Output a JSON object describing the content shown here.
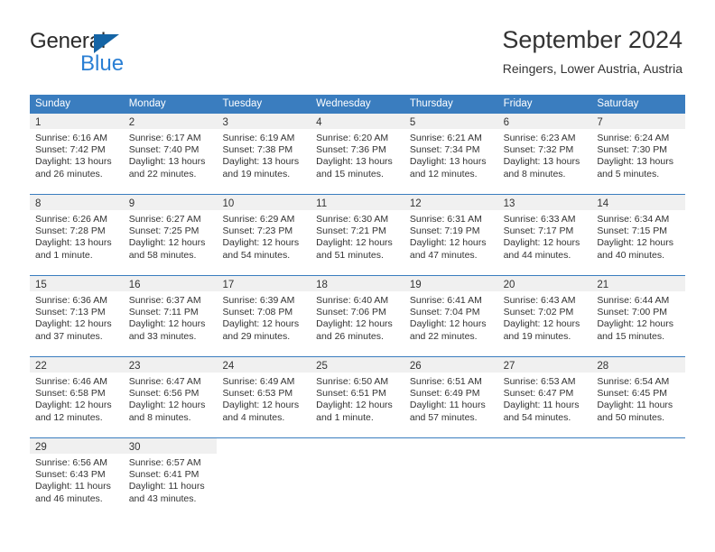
{
  "brand": {
    "name_dark": "General",
    "name_blue": "Blue",
    "triangle_color": "#1464a5",
    "blue_color": "#2a7fd4"
  },
  "header": {
    "title": "September 2024",
    "subtitle": "Reingers, Lower Austria, Austria"
  },
  "theme": {
    "header_bg": "#3a7dbf",
    "header_text": "#ffffff",
    "day_band_bg": "#f0f0f0",
    "row_border": "#3a7dbf",
    "text": "#333333"
  },
  "weekdays": [
    "Sunday",
    "Monday",
    "Tuesday",
    "Wednesday",
    "Thursday",
    "Friday",
    "Saturday"
  ],
  "weeks": [
    {
      "days": [
        {
          "num": "1",
          "sunrise": "Sunrise: 6:16 AM",
          "sunset": "Sunset: 7:42 PM",
          "daylight_1": "Daylight: 13 hours",
          "daylight_2": "and 26 minutes."
        },
        {
          "num": "2",
          "sunrise": "Sunrise: 6:17 AM",
          "sunset": "Sunset: 7:40 PM",
          "daylight_1": "Daylight: 13 hours",
          "daylight_2": "and 22 minutes."
        },
        {
          "num": "3",
          "sunrise": "Sunrise: 6:19 AM",
          "sunset": "Sunset: 7:38 PM",
          "daylight_1": "Daylight: 13 hours",
          "daylight_2": "and 19 minutes."
        },
        {
          "num": "4",
          "sunrise": "Sunrise: 6:20 AM",
          "sunset": "Sunset: 7:36 PM",
          "daylight_1": "Daylight: 13 hours",
          "daylight_2": "and 15 minutes."
        },
        {
          "num": "5",
          "sunrise": "Sunrise: 6:21 AM",
          "sunset": "Sunset: 7:34 PM",
          "daylight_1": "Daylight: 13 hours",
          "daylight_2": "and 12 minutes."
        },
        {
          "num": "6",
          "sunrise": "Sunrise: 6:23 AM",
          "sunset": "Sunset: 7:32 PM",
          "daylight_1": "Daylight: 13 hours",
          "daylight_2": "and 8 minutes."
        },
        {
          "num": "7",
          "sunrise": "Sunrise: 6:24 AM",
          "sunset": "Sunset: 7:30 PM",
          "daylight_1": "Daylight: 13 hours",
          "daylight_2": "and 5 minutes."
        }
      ]
    },
    {
      "days": [
        {
          "num": "8",
          "sunrise": "Sunrise: 6:26 AM",
          "sunset": "Sunset: 7:28 PM",
          "daylight_1": "Daylight: 13 hours",
          "daylight_2": "and 1 minute."
        },
        {
          "num": "9",
          "sunrise": "Sunrise: 6:27 AM",
          "sunset": "Sunset: 7:25 PM",
          "daylight_1": "Daylight: 12 hours",
          "daylight_2": "and 58 minutes."
        },
        {
          "num": "10",
          "sunrise": "Sunrise: 6:29 AM",
          "sunset": "Sunset: 7:23 PM",
          "daylight_1": "Daylight: 12 hours",
          "daylight_2": "and 54 minutes."
        },
        {
          "num": "11",
          "sunrise": "Sunrise: 6:30 AM",
          "sunset": "Sunset: 7:21 PM",
          "daylight_1": "Daylight: 12 hours",
          "daylight_2": "and 51 minutes."
        },
        {
          "num": "12",
          "sunrise": "Sunrise: 6:31 AM",
          "sunset": "Sunset: 7:19 PM",
          "daylight_1": "Daylight: 12 hours",
          "daylight_2": "and 47 minutes."
        },
        {
          "num": "13",
          "sunrise": "Sunrise: 6:33 AM",
          "sunset": "Sunset: 7:17 PM",
          "daylight_1": "Daylight: 12 hours",
          "daylight_2": "and 44 minutes."
        },
        {
          "num": "14",
          "sunrise": "Sunrise: 6:34 AM",
          "sunset": "Sunset: 7:15 PM",
          "daylight_1": "Daylight: 12 hours",
          "daylight_2": "and 40 minutes."
        }
      ]
    },
    {
      "days": [
        {
          "num": "15",
          "sunrise": "Sunrise: 6:36 AM",
          "sunset": "Sunset: 7:13 PM",
          "daylight_1": "Daylight: 12 hours",
          "daylight_2": "and 37 minutes."
        },
        {
          "num": "16",
          "sunrise": "Sunrise: 6:37 AM",
          "sunset": "Sunset: 7:11 PM",
          "daylight_1": "Daylight: 12 hours",
          "daylight_2": "and 33 minutes."
        },
        {
          "num": "17",
          "sunrise": "Sunrise: 6:39 AM",
          "sunset": "Sunset: 7:08 PM",
          "daylight_1": "Daylight: 12 hours",
          "daylight_2": "and 29 minutes."
        },
        {
          "num": "18",
          "sunrise": "Sunrise: 6:40 AM",
          "sunset": "Sunset: 7:06 PM",
          "daylight_1": "Daylight: 12 hours",
          "daylight_2": "and 26 minutes."
        },
        {
          "num": "19",
          "sunrise": "Sunrise: 6:41 AM",
          "sunset": "Sunset: 7:04 PM",
          "daylight_1": "Daylight: 12 hours",
          "daylight_2": "and 22 minutes."
        },
        {
          "num": "20",
          "sunrise": "Sunrise: 6:43 AM",
          "sunset": "Sunset: 7:02 PM",
          "daylight_1": "Daylight: 12 hours",
          "daylight_2": "and 19 minutes."
        },
        {
          "num": "21",
          "sunrise": "Sunrise: 6:44 AM",
          "sunset": "Sunset: 7:00 PM",
          "daylight_1": "Daylight: 12 hours",
          "daylight_2": "and 15 minutes."
        }
      ]
    },
    {
      "days": [
        {
          "num": "22",
          "sunrise": "Sunrise: 6:46 AM",
          "sunset": "Sunset: 6:58 PM",
          "daylight_1": "Daylight: 12 hours",
          "daylight_2": "and 12 minutes."
        },
        {
          "num": "23",
          "sunrise": "Sunrise: 6:47 AM",
          "sunset": "Sunset: 6:56 PM",
          "daylight_1": "Daylight: 12 hours",
          "daylight_2": "and 8 minutes."
        },
        {
          "num": "24",
          "sunrise": "Sunrise: 6:49 AM",
          "sunset": "Sunset: 6:53 PM",
          "daylight_1": "Daylight: 12 hours",
          "daylight_2": "and 4 minutes."
        },
        {
          "num": "25",
          "sunrise": "Sunrise: 6:50 AM",
          "sunset": "Sunset: 6:51 PM",
          "daylight_1": "Daylight: 12 hours",
          "daylight_2": "and 1 minute."
        },
        {
          "num": "26",
          "sunrise": "Sunrise: 6:51 AM",
          "sunset": "Sunset: 6:49 PM",
          "daylight_1": "Daylight: 11 hours",
          "daylight_2": "and 57 minutes."
        },
        {
          "num": "27",
          "sunrise": "Sunrise: 6:53 AM",
          "sunset": "Sunset: 6:47 PM",
          "daylight_1": "Daylight: 11 hours",
          "daylight_2": "and 54 minutes."
        },
        {
          "num": "28",
          "sunrise": "Sunrise: 6:54 AM",
          "sunset": "Sunset: 6:45 PM",
          "daylight_1": "Daylight: 11 hours",
          "daylight_2": "and 50 minutes."
        }
      ]
    },
    {
      "days": [
        {
          "num": "29",
          "sunrise": "Sunrise: 6:56 AM",
          "sunset": "Sunset: 6:43 PM",
          "daylight_1": "Daylight: 11 hours",
          "daylight_2": "and 46 minutes."
        },
        {
          "num": "30",
          "sunrise": "Sunrise: 6:57 AM",
          "sunset": "Sunset: 6:41 PM",
          "daylight_1": "Daylight: 11 hours",
          "daylight_2": "and 43 minutes."
        },
        {
          "num": "",
          "sunrise": "",
          "sunset": "",
          "daylight_1": "",
          "daylight_2": ""
        },
        {
          "num": "",
          "sunrise": "",
          "sunset": "",
          "daylight_1": "",
          "daylight_2": ""
        },
        {
          "num": "",
          "sunrise": "",
          "sunset": "",
          "daylight_1": "",
          "daylight_2": ""
        },
        {
          "num": "",
          "sunrise": "",
          "sunset": "",
          "daylight_1": "",
          "daylight_2": ""
        },
        {
          "num": "",
          "sunrise": "",
          "sunset": "",
          "daylight_1": "",
          "daylight_2": ""
        }
      ]
    }
  ]
}
